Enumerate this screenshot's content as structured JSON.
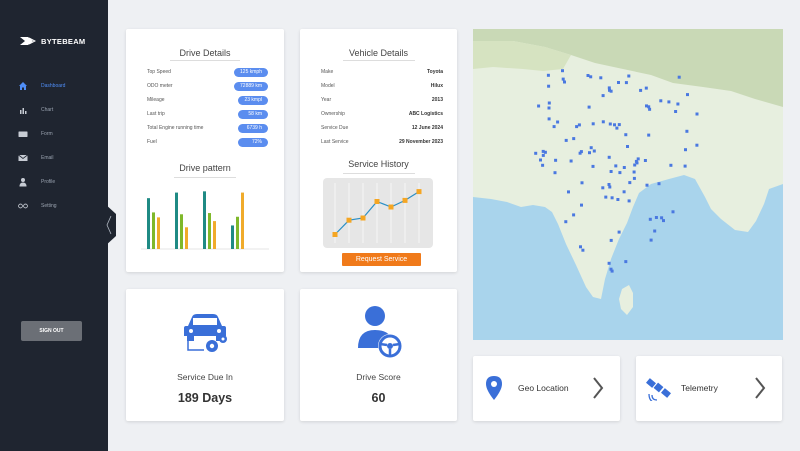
{
  "brand": {
    "name": "BYTEBEAM"
  },
  "sidebar": {
    "items": [
      {
        "label": "Dashboard",
        "icon": "home-icon",
        "active": true
      },
      {
        "label": "Chart",
        "icon": "bar-chart-icon",
        "active": false
      },
      {
        "label": "Form",
        "icon": "keyboard-icon",
        "active": false
      },
      {
        "label": "Email",
        "icon": "envelope-icon",
        "active": false
      },
      {
        "label": "Profile",
        "icon": "person-icon",
        "active": false
      },
      {
        "label": "Setting",
        "icon": "toggle-icon",
        "active": false
      }
    ],
    "signout_label": "SIGN OUT"
  },
  "drive_details": {
    "title": "Drive Details",
    "rows": [
      {
        "label": "Top Speed",
        "value": "125 kmph"
      },
      {
        "label": "ODO meter",
        "value": "72889 km"
      },
      {
        "label": "Mileage",
        "value": "23 kmpl"
      },
      {
        "label": "Last trip",
        "value": "58 km"
      },
      {
        "label": "Total Engine running time",
        "value": "6739 h"
      },
      {
        "label": "Fuel",
        "value": "72%"
      }
    ],
    "pattern_title": "Drive pattern"
  },
  "drive_pattern_chart": {
    "type": "bar",
    "colors": [
      "#1f8a84",
      "#7fb82a",
      "#f0ab2b"
    ],
    "groups": [
      [
        0.82,
        0.59,
        0.51
      ],
      [
        0.91,
        0.56,
        0.35
      ],
      [
        0.93,
        0.58,
        0.45
      ],
      [
        0.38,
        0.52,
        0.91
      ]
    ]
  },
  "vehicle_details": {
    "title": "Vehicle Details",
    "rows": [
      {
        "label": "Make",
        "value": "Toyota"
      },
      {
        "label": "Model",
        "value": "Hilux"
      },
      {
        "label": "Year",
        "value": "2013"
      },
      {
        "label": "Ownership",
        "value": "ABC Logistics"
      },
      {
        "label": "Service Due",
        "value": "12 June 2024"
      },
      {
        "label": "Last Service",
        "value": "29 November 2023"
      }
    ],
    "history_title": "Service History",
    "request_label": "Request Service"
  },
  "service_history_chart": {
    "type": "line",
    "color": "#f5a623",
    "line_color": "#2a8fc6",
    "values": [
      0.1,
      0.36,
      0.4,
      0.7,
      0.6,
      0.72,
      0.88
    ]
  },
  "service_due": {
    "label": "Service Due In",
    "value": "189 Days",
    "icon": "car-service-icon"
  },
  "drive_score": {
    "label": "Drive Score",
    "value": "60",
    "icon": "driver-icon"
  },
  "geo_location": {
    "label": "Geo Location",
    "icon": "location-pin-icon"
  },
  "telemetry": {
    "label": "Telemetry",
    "icon": "satellite-icon"
  },
  "theme": {
    "accent": "#5b8def",
    "orange": "#f07a1a",
    "sidebar": "#1f2530",
    "icon_blue": "#3a6fd8"
  }
}
